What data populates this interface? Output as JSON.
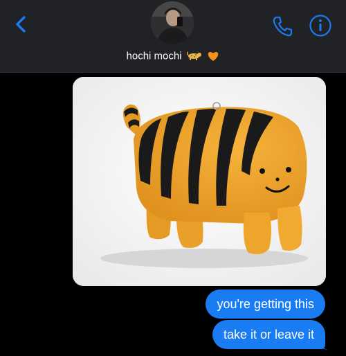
{
  "header": {
    "contact_name": "hochi mochi",
    "name_emojis": [
      "leopard",
      "orange-heart"
    ],
    "back_icon": "chevron-left-icon",
    "call_icon": "phone-icon",
    "info_icon": "info-icon",
    "accent_color": "#1a7cf2"
  },
  "messages": [
    {
      "type": "image",
      "direction": "outgoing",
      "content": "orange tiger-striped plush toy"
    },
    {
      "type": "text",
      "direction": "outgoing",
      "text": "you're getting this"
    },
    {
      "type": "text",
      "direction": "outgoing",
      "text": "take it or leave it"
    }
  ],
  "colors": {
    "background": "#000000",
    "header": "#202226",
    "bubble": "#1a7cf2"
  }
}
